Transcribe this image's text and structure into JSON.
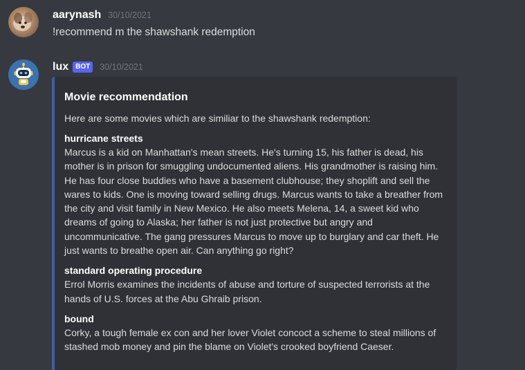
{
  "messages": [
    {
      "username": "aarynash",
      "timestamp": "30/10/2021",
      "content": "!recommend m the shawshank redemption"
    },
    {
      "username": "lux",
      "bot_tag": "BOT",
      "timestamp": "30/10/2021",
      "embed": {
        "title": "Movie recommendation",
        "description": "Here are some movies which are similiar to the shawshank redemption:",
        "accent_color": "#3a5fa8",
        "fields": [
          {
            "name": "hurricane streets",
            "value": "Marcus is a kid on Manhattan's mean streets. He's turning 15, his father is dead, his mother is in prison for smuggling undocumented aliens. His grandmother is raising him. He has four close buddies who have a basement clubhouse; they shoplift and sell the wares to kids. One is moving toward selling drugs. Marcus wants to take a breather from the city and visit family in New Mexico. He also meets Melena, 14, a sweet kid who dreams of going to Alaska; her father is not just protective but angry and uncommunicative. The gang pressures Marcus to move up to burglary and car theft. He just wants to breathe open air. Can anything go right?"
          },
          {
            "name": "standard operating procedure",
            "value": "Errol Morris examines the incidents of abuse and torture of suspected terrorists at the hands of U.S. forces at the Abu Ghraib prison."
          },
          {
            "name": "bound",
            "value": "Corky, a tough female ex con and her lover Violet concoct a scheme to steal millions of stashed mob money and pin the blame on Violet's crooked boyfriend Caeser."
          }
        ]
      }
    }
  ],
  "colors": {
    "background": "#36393f",
    "embed_background": "#2f3136",
    "bot_tag": "#5865f2"
  },
  "icons": {
    "bot_avatar": "robot-icon"
  }
}
